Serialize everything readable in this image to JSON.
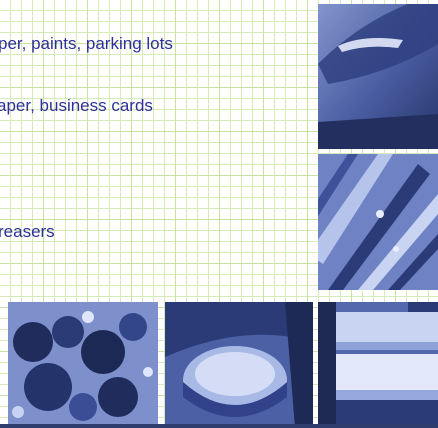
{
  "content": {
    "text_lines": [
      "per, paints, parking lots",
      "aper, business cards",
      "reasers"
    ]
  },
  "colors": {
    "text": "#2e2f99",
    "grid_minor": "#d6ecb8",
    "grid_major": "#c7e3a2",
    "photo_tint_dark": "#2a3b75",
    "photo_tint_light": "#9fb1df"
  },
  "images": [
    {
      "name": "lamp-photo"
    },
    {
      "name": "striped-fabric-photo"
    },
    {
      "name": "flowers-photo"
    },
    {
      "name": "bowl-photo"
    },
    {
      "name": "paper-stack-photo"
    }
  ]
}
